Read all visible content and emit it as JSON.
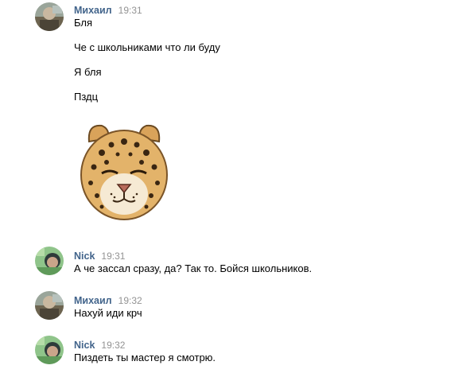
{
  "messages": [
    {
      "author": "Михаил",
      "time": "19:31",
      "avatar_icon": "user-photo-mikhail",
      "lines": [
        "Бля",
        "Че с школьниками что ли буду",
        "Я бля",
        "Пздц"
      ],
      "sticker_icon": "leopard-sticker"
    },
    {
      "author": "Nick",
      "time": "19:31",
      "avatar_icon": "user-photo-nick",
      "lines": [
        "А че зассал сразу, да? Так то. Бойся школьников."
      ]
    },
    {
      "author": "Михаил",
      "time": "19:32",
      "avatar_icon": "user-photo-mikhail",
      "lines": [
        "Нахуй иди крч"
      ]
    },
    {
      "author": "Nick",
      "time": "19:32",
      "avatar_icon": "user-photo-nick",
      "lines": [
        "Пиздеть ты мастер я смотрю."
      ]
    }
  ],
  "colors": {
    "author": "#42648b",
    "time": "#939393",
    "text": "#000000",
    "background": "#ffffff"
  }
}
